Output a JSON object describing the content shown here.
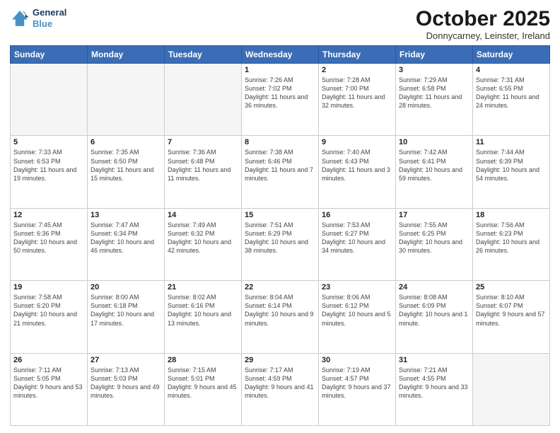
{
  "header": {
    "logo_line1": "General",
    "logo_line2": "Blue",
    "title": "October 2025",
    "subtitle": "Donnycarney, Leinster, Ireland"
  },
  "days_of_week": [
    "Sunday",
    "Monday",
    "Tuesday",
    "Wednesday",
    "Thursday",
    "Friday",
    "Saturday"
  ],
  "weeks": [
    [
      {
        "day": "",
        "empty": true
      },
      {
        "day": "",
        "empty": true
      },
      {
        "day": "",
        "empty": true
      },
      {
        "day": "1",
        "sunrise": "7:26 AM",
        "sunset": "7:02 PM",
        "daylight": "11 hours and 36 minutes."
      },
      {
        "day": "2",
        "sunrise": "7:28 AM",
        "sunset": "7:00 PM",
        "daylight": "11 hours and 32 minutes."
      },
      {
        "day": "3",
        "sunrise": "7:29 AM",
        "sunset": "6:58 PM",
        "daylight": "11 hours and 28 minutes."
      },
      {
        "day": "4",
        "sunrise": "7:31 AM",
        "sunset": "6:55 PM",
        "daylight": "11 hours and 24 minutes."
      }
    ],
    [
      {
        "day": "5",
        "sunrise": "7:33 AM",
        "sunset": "6:53 PM",
        "daylight": "11 hours and 19 minutes."
      },
      {
        "day": "6",
        "sunrise": "7:35 AM",
        "sunset": "6:50 PM",
        "daylight": "11 hours and 15 minutes."
      },
      {
        "day": "7",
        "sunrise": "7:36 AM",
        "sunset": "6:48 PM",
        "daylight": "11 hours and 11 minutes."
      },
      {
        "day": "8",
        "sunrise": "7:38 AM",
        "sunset": "6:46 PM",
        "daylight": "11 hours and 7 minutes."
      },
      {
        "day": "9",
        "sunrise": "7:40 AM",
        "sunset": "6:43 PM",
        "daylight": "11 hours and 3 minutes."
      },
      {
        "day": "10",
        "sunrise": "7:42 AM",
        "sunset": "6:41 PM",
        "daylight": "10 hours and 59 minutes."
      },
      {
        "day": "11",
        "sunrise": "7:44 AM",
        "sunset": "6:39 PM",
        "daylight": "10 hours and 54 minutes."
      }
    ],
    [
      {
        "day": "12",
        "sunrise": "7:45 AM",
        "sunset": "6:36 PM",
        "daylight": "10 hours and 50 minutes."
      },
      {
        "day": "13",
        "sunrise": "7:47 AM",
        "sunset": "6:34 PM",
        "daylight": "10 hours and 46 minutes."
      },
      {
        "day": "14",
        "sunrise": "7:49 AM",
        "sunset": "6:32 PM",
        "daylight": "10 hours and 42 minutes."
      },
      {
        "day": "15",
        "sunrise": "7:51 AM",
        "sunset": "6:29 PM",
        "daylight": "10 hours and 38 minutes."
      },
      {
        "day": "16",
        "sunrise": "7:53 AM",
        "sunset": "6:27 PM",
        "daylight": "10 hours and 34 minutes."
      },
      {
        "day": "17",
        "sunrise": "7:55 AM",
        "sunset": "6:25 PM",
        "daylight": "10 hours and 30 minutes."
      },
      {
        "day": "18",
        "sunrise": "7:56 AM",
        "sunset": "6:23 PM",
        "daylight": "10 hours and 26 minutes."
      }
    ],
    [
      {
        "day": "19",
        "sunrise": "7:58 AM",
        "sunset": "6:20 PM",
        "daylight": "10 hours and 21 minutes."
      },
      {
        "day": "20",
        "sunrise": "8:00 AM",
        "sunset": "6:18 PM",
        "daylight": "10 hours and 17 minutes."
      },
      {
        "day": "21",
        "sunrise": "8:02 AM",
        "sunset": "6:16 PM",
        "daylight": "10 hours and 13 minutes."
      },
      {
        "day": "22",
        "sunrise": "8:04 AM",
        "sunset": "6:14 PM",
        "daylight": "10 hours and 9 minutes."
      },
      {
        "day": "23",
        "sunrise": "8:06 AM",
        "sunset": "6:12 PM",
        "daylight": "10 hours and 5 minutes."
      },
      {
        "day": "24",
        "sunrise": "8:08 AM",
        "sunset": "6:09 PM",
        "daylight": "10 hours and 1 minute."
      },
      {
        "day": "25",
        "sunrise": "8:10 AM",
        "sunset": "6:07 PM",
        "daylight": "9 hours and 57 minutes."
      }
    ],
    [
      {
        "day": "26",
        "sunrise": "7:11 AM",
        "sunset": "5:05 PM",
        "daylight": "9 hours and 53 minutes."
      },
      {
        "day": "27",
        "sunrise": "7:13 AM",
        "sunset": "5:03 PM",
        "daylight": "9 hours and 49 minutes."
      },
      {
        "day": "28",
        "sunrise": "7:15 AM",
        "sunset": "5:01 PM",
        "daylight": "9 hours and 45 minutes."
      },
      {
        "day": "29",
        "sunrise": "7:17 AM",
        "sunset": "4:59 PM",
        "daylight": "9 hours and 41 minutes."
      },
      {
        "day": "30",
        "sunrise": "7:19 AM",
        "sunset": "4:57 PM",
        "daylight": "9 hours and 37 minutes."
      },
      {
        "day": "31",
        "sunrise": "7:21 AM",
        "sunset": "4:55 PM",
        "daylight": "9 hours and 33 minutes."
      },
      {
        "day": "",
        "empty": true
      }
    ]
  ]
}
